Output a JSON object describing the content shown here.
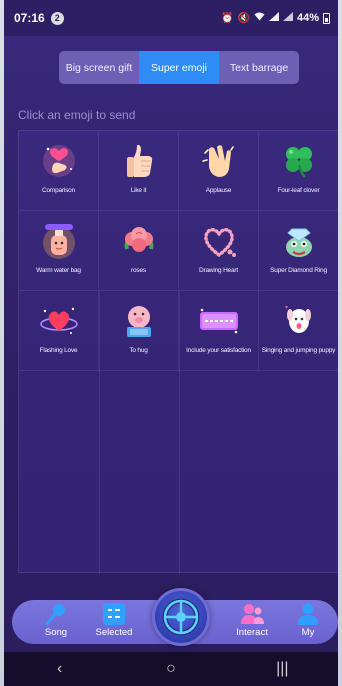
{
  "status_bar": {
    "time": "07:16",
    "notification_count": "2",
    "battery": "44%"
  },
  "tabs": [
    {
      "label": "Big screen gift",
      "active": false
    },
    {
      "label": "Super emoji",
      "active": true
    },
    {
      "label": "Text barrage",
      "active": false
    }
  ],
  "hint": "Click an emoji to send",
  "emojis": [
    {
      "label": "Comparison",
      "icon": "heart-hand-icon"
    },
    {
      "label": "Like it",
      "icon": "thumbs-up-icon"
    },
    {
      "label": "Applause",
      "icon": "clap-icon"
    },
    {
      "label": "Four-leaf clover",
      "icon": "clover-icon"
    },
    {
      "label": "Warm water bag",
      "icon": "warm-water-bag-icon"
    },
    {
      "label": "roses",
      "icon": "rose-icon"
    },
    {
      "label": "Drawing Heart",
      "icon": "pearl-heart-icon"
    },
    {
      "label": "Super Diamond Ring",
      "icon": "diamond-ring-icon"
    },
    {
      "label": "Flashing Love",
      "icon": "flashing-heart-icon"
    },
    {
      "label": "To hug",
      "icon": "hug-pig-icon"
    },
    {
      "label": "Include your satisfaction",
      "icon": "satisfaction-banner-icon"
    },
    {
      "label": "Singing and jumping puppy",
      "icon": "puppy-icon"
    }
  ],
  "bottom_nav": {
    "song": "Song",
    "selected": "Selected",
    "interact": "Interact",
    "my": "My"
  },
  "colors": {
    "accent": "#2f8cf6",
    "tab_bar": "#6d5fb4",
    "nav_bar": "#6a62cf"
  }
}
